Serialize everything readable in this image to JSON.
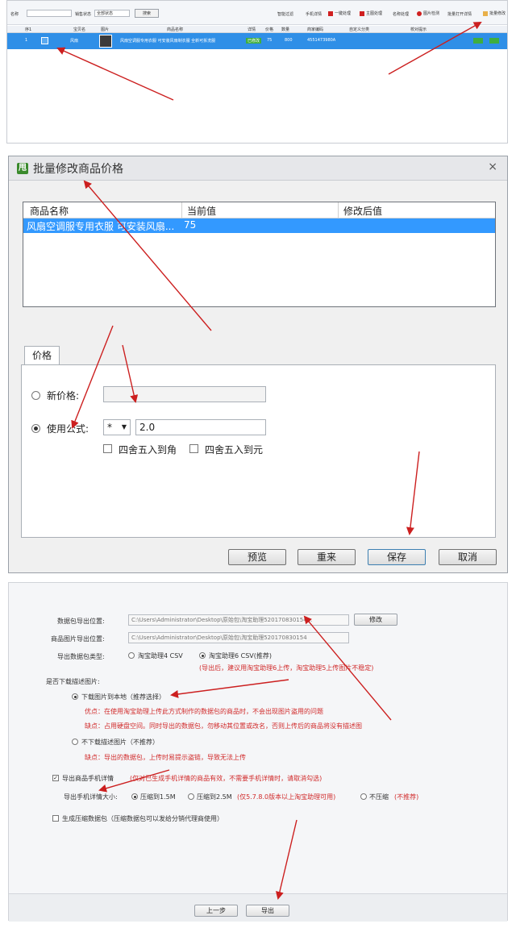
{
  "top_window": {
    "filter_label": "名称",
    "status_label": "销售状态",
    "status_value": "全部状态",
    "search_button": "搜索",
    "toolbar": {
      "smart_filter": "智能过滤",
      "mobile_detail": "手机详情",
      "one_click": "一键处理",
      "theme": "主图处理",
      "name": "名称处理",
      "image_check": "图片检测",
      "batch_print": "批量打开详情",
      "batch_edit": "批量修改"
    },
    "columns": [
      "序1",
      "",
      "宝贝名",
      "图片",
      "商品名称",
      "详情",
      "价格",
      "数量",
      "商家编码",
      "自定义分类",
      "校对提示"
    ],
    "row": {
      "seq": "1",
      "title": "风扇",
      "name": "风扇空调服专用衣服 可安装风扇制衣服 全新可拆洗服",
      "detail": "已修改",
      "price": "75",
      "qty": "800",
      "code": "4551473980A"
    }
  },
  "dialog": {
    "title": "批量修改商品价格",
    "close": "×",
    "logo": "甩",
    "list": {
      "headers": [
        "商品名称",
        "当前值",
        "修改后值"
      ],
      "rows": [
        [
          "风扇空调服专用衣服 可安装风扇...",
          "75",
          ""
        ]
      ]
    },
    "tab": "价格",
    "new_price_label": "新价格:",
    "formula_label": "使用公式:",
    "operator": "*",
    "formula_value": "2.0",
    "round_jiao": "四舍五入到角",
    "round_yuan": "四舍五入到元",
    "buttons": {
      "preview": "预览",
      "reset": "重来",
      "save": "保存",
      "cancel": "取消"
    }
  },
  "export": {
    "pkg_path_label": "数据包导出位置:",
    "pkg_path": "C:\\Users\\Administrator\\Desktop\\原始包\\淘宝助理520170830154...",
    "modify_button": "修改",
    "img_path_label": "商品图片导出位置:",
    "img_path": "C:\\Users\\Administrator\\Desktop\\原始包\\淘宝助理520170830154",
    "type_label": "导出数据包类型:",
    "type_opt1": "淘宝助理4 CSV",
    "type_opt2": "淘宝助理6 CSV(推荐)",
    "type_note": "(导出后，建议用淘宝助理6上传，淘宝助理5上传图片不稳定)",
    "download_q": "是否下载描述图片:",
    "dl_opt1": "下载图片到本地（推荐选择）",
    "dl_adv": "优点：在使用淘宝助理上传此方式制作的数据包的商品时，不会出现图片盗用的问题",
    "dl_dis": "缺点：占用硬盘空间。同时导出的数据包，勿移动其位置或改名，否则上传后的商品将没有描述图",
    "dl_opt2": "不下载描述图片（不推荐）",
    "dl_opt2_dis": "缺点：导出的数据包，上传时易提示盗链，导致无法上传",
    "mobile_chk": "导出商品手机详情",
    "mobile_note": "(仅对已生成手机详情的商品有效，不需要手机详情时，请取消勾选)",
    "mobile_size_label": "导出手机详情大小:",
    "size_opt1": "压缩到1.5M",
    "size_opt2": "压缩到2.5M",
    "size_note": "(仅5.7.8.0版本以上淘宝助理可用)",
    "size_opt3": "不压缩",
    "size_opt3_note": "(不推荐)",
    "zip_chk": "生成压缩数据包（压缩数据包可以发给分销代理商使用）",
    "prev_button": "上一步",
    "export_button": "导出"
  },
  "colors": {
    "selection": "#3399ff",
    "arrow": "#cc1f1f",
    "accent_green": "#3a8a2c"
  }
}
